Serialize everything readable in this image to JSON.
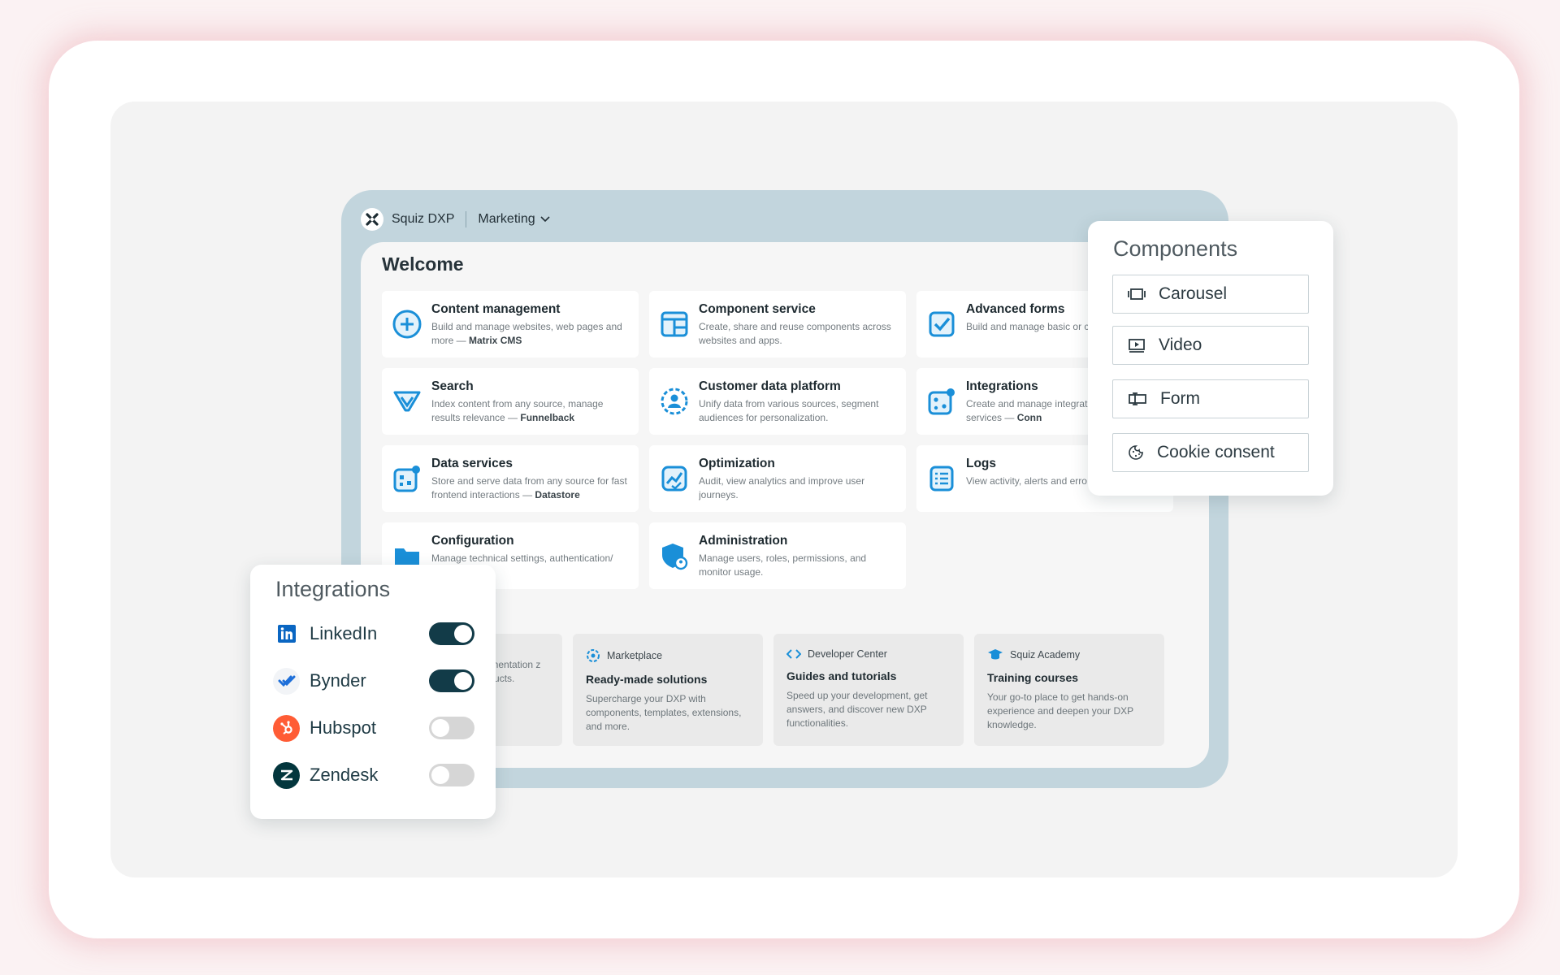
{
  "app": {
    "name": "Squiz DXP",
    "workspace": "Marketing",
    "welcome": "Welcome",
    "accent_color": "#1a8fd8"
  },
  "services": [
    {
      "title": "Content management",
      "desc": "Build and manage websites, web pages and more — ",
      "strong": "Matrix CMS",
      "icon": "plus-circle-icon"
    },
    {
      "title": "Component service",
      "desc": "Create, share and reuse components across websites and apps.",
      "strong": "",
      "icon": "layout-grid-icon"
    },
    {
      "title": "Advanced forms",
      "desc": "Build and manage basic or c",
      "strong": "",
      "icon": "checkbox-icon"
    },
    {
      "title": "Search",
      "desc": "Index content from any source, manage results relevance — ",
      "strong": "Funnelback",
      "icon": "funnel-icon"
    },
    {
      "title": "Customer data platform",
      "desc": "Unify data from various sources, segment audiences for personalization.",
      "strong": "",
      "icon": "user-target-icon"
    },
    {
      "title": "Integrations",
      "desc": "Create and manage integrat third party services — ",
      "strong": "Conn",
      "icon": "integrations-icon"
    },
    {
      "title": "Data services",
      "desc": "Store and serve data from any source for fast frontend interactions — ",
      "strong": "Datastore",
      "icon": "database-icon"
    },
    {
      "title": "Optimization",
      "desc": "Audit, view analytics and improve user journeys.",
      "strong": "",
      "icon": "chart-check-icon"
    },
    {
      "title": "Logs",
      "desc": "View activity, alerts and erro tech stack.",
      "strong": "",
      "icon": "list-icon"
    },
    {
      "title": "Configuration",
      "desc": "Manage technical settings, authentication/ mation.",
      "strong": "",
      "icon": "folder-gear-icon"
    },
    {
      "title": "Administration",
      "desc": "Manage users, roles, permissions, and monitor usage.",
      "strong": "",
      "icon": "shield-user-icon"
    }
  ],
  "resources": [
    {
      "head": "",
      "title": "",
      "desc": "ocumentation z products.",
      "icon": ""
    },
    {
      "head": "Marketplace",
      "title": "Ready-made solutions",
      "desc": "Supercharge your DXP with components, templates, extensions, and more.",
      "icon": "marketplace-icon"
    },
    {
      "head": "Developer Center",
      "title": "Guides and tutorials",
      "desc": "Speed up your development, get answers, and discover new DXP functionalities.",
      "icon": "code-icon"
    },
    {
      "head": "Squiz Academy",
      "title": "Training courses",
      "desc": "Your go-to place to get hands-on experience and deepen your DXP knowledge.",
      "icon": "graduation-cap-icon"
    }
  ],
  "components": {
    "title": "Components",
    "items": [
      {
        "label": "Carousel",
        "icon": "carousel-icon"
      },
      {
        "label": "Video",
        "icon": "video-icon"
      },
      {
        "label": "Form",
        "icon": "form-icon"
      },
      {
        "label": "Cookie consent",
        "icon": "cookie-icon"
      }
    ]
  },
  "integrations": {
    "title": "Integrations",
    "items": [
      {
        "label": "LinkedIn",
        "enabled": true,
        "icon": "linkedin-icon",
        "color": "#0a66c2"
      },
      {
        "label": "Bynder",
        "enabled": true,
        "icon": "bynder-icon",
        "color": "#1e6fd9"
      },
      {
        "label": "Hubspot",
        "enabled": false,
        "icon": "hubspot-icon",
        "color": "#ff5c35"
      },
      {
        "label": "Zendesk",
        "enabled": false,
        "icon": "zendesk-icon",
        "color": "#03363d"
      }
    ]
  }
}
